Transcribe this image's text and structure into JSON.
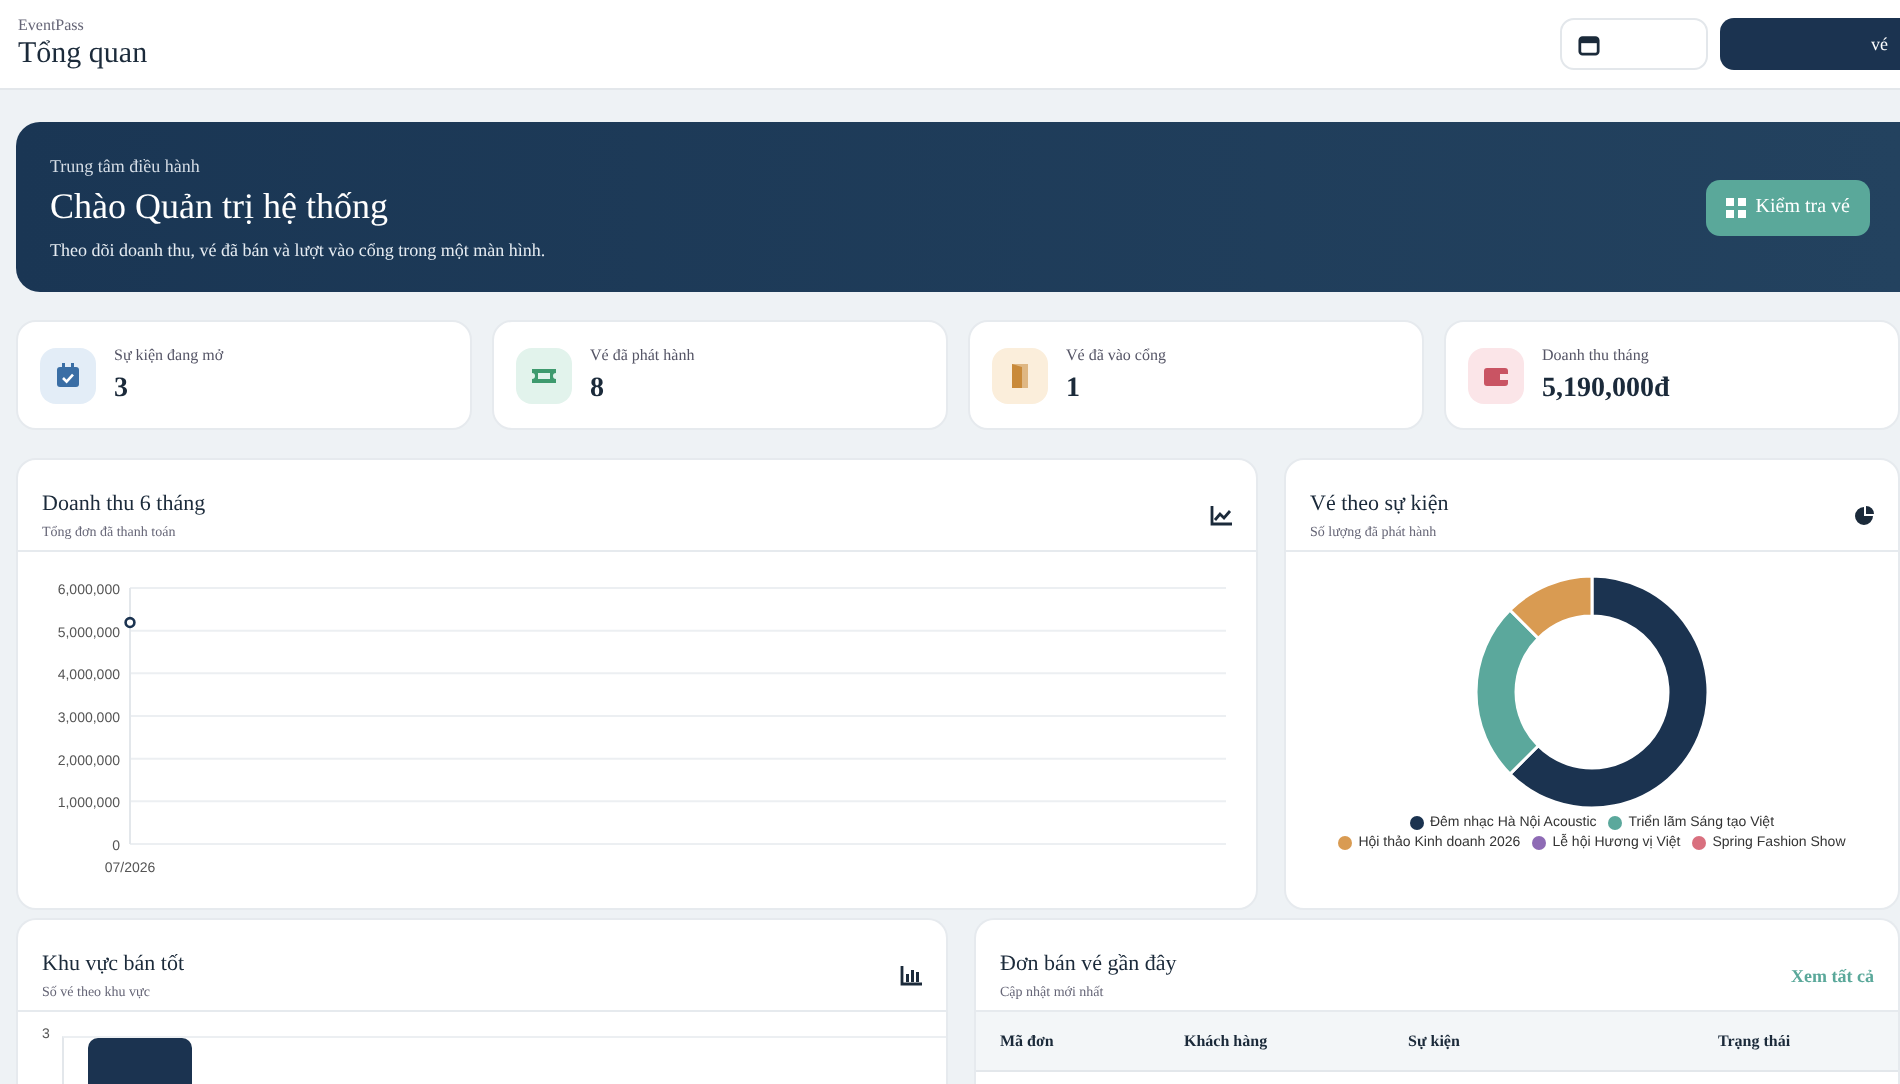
{
  "header": {
    "app_name": "EventPass",
    "title": "Tổng quan",
    "primary_button": "vé"
  },
  "hero": {
    "eyebrow": "Trung tâm điều hành",
    "title": "Chào Quản trị hệ thống",
    "description": "Theo dõi doanh thu, vé đã bán và lượt vào cổng trong một màn hình.",
    "button": "Kiểm tra vé"
  },
  "stats": [
    {
      "kind": "calendar",
      "label": "Sự kiện đang mở",
      "value": "3"
    },
    {
      "kind": "ticket",
      "label": "Vé đã phát hành",
      "value": "8"
    },
    {
      "kind": "door",
      "label": "Vé đã vào cổng",
      "value": "1"
    },
    {
      "kind": "wallet",
      "label": "Doanh thu tháng",
      "value": "5,190,000đ"
    }
  ],
  "revenue_card": {
    "title": "Doanh thu 6 tháng",
    "subtitle": "Tổng đơn đã thanh toán",
    "chart_data": {
      "type": "line",
      "categories": [
        "07/2026"
      ],
      "series": [
        {
          "color": "#1b3350",
          "marker": true,
          "values": [
            5190000
          ]
        }
      ],
      "grid": true,
      "ylim": [
        0,
        6000000
      ],
      "yticks": [
        {
          "value": 0,
          "label": "0"
        },
        {
          "value": 1000000,
          "label": "1,000,000"
        },
        {
          "value": 2000000,
          "label": "2,000,000"
        },
        {
          "value": 3000000,
          "label": "3,000,000"
        },
        {
          "value": 4000000,
          "label": "4,000,000"
        },
        {
          "value": 5000000,
          "label": "5,000,000"
        },
        {
          "value": 6000000,
          "label": "6,000,000"
        }
      ]
    }
  },
  "tickets_card": {
    "title": "Vé theo sự kiện",
    "subtitle": "Số lượng đã phát hành",
    "chart_data": {
      "type": "donut",
      "categories": [
        "Đêm nhạc Hà Nội Acoustic",
        "Triển lãm Sáng tạo Việt",
        "Hội thảo Kinh doanh 2026",
        "Lễ hội Hương vị Việt",
        "Spring Fashion Show"
      ],
      "values": [
        62.5,
        25,
        12.5,
        0,
        0
      ],
      "legend": "bottom",
      "colors": [
        "#1b3350",
        "#5ba89c",
        "#d99b52",
        "#8e6bb5",
        "#d9707f"
      ]
    }
  },
  "zones_card": {
    "title": "Khu vực bán tốt",
    "subtitle": "Số vé theo khu vực",
    "y_tick_label": "3"
  },
  "orders_card": {
    "title": "Đơn bán vé gần đây",
    "subtitle": "Cập nhật mới nhất",
    "link": "Xem tất cả",
    "columns": [
      "Mã đơn",
      "Khách hàng",
      "Sự kiện",
      "Trạng thái"
    ]
  }
}
